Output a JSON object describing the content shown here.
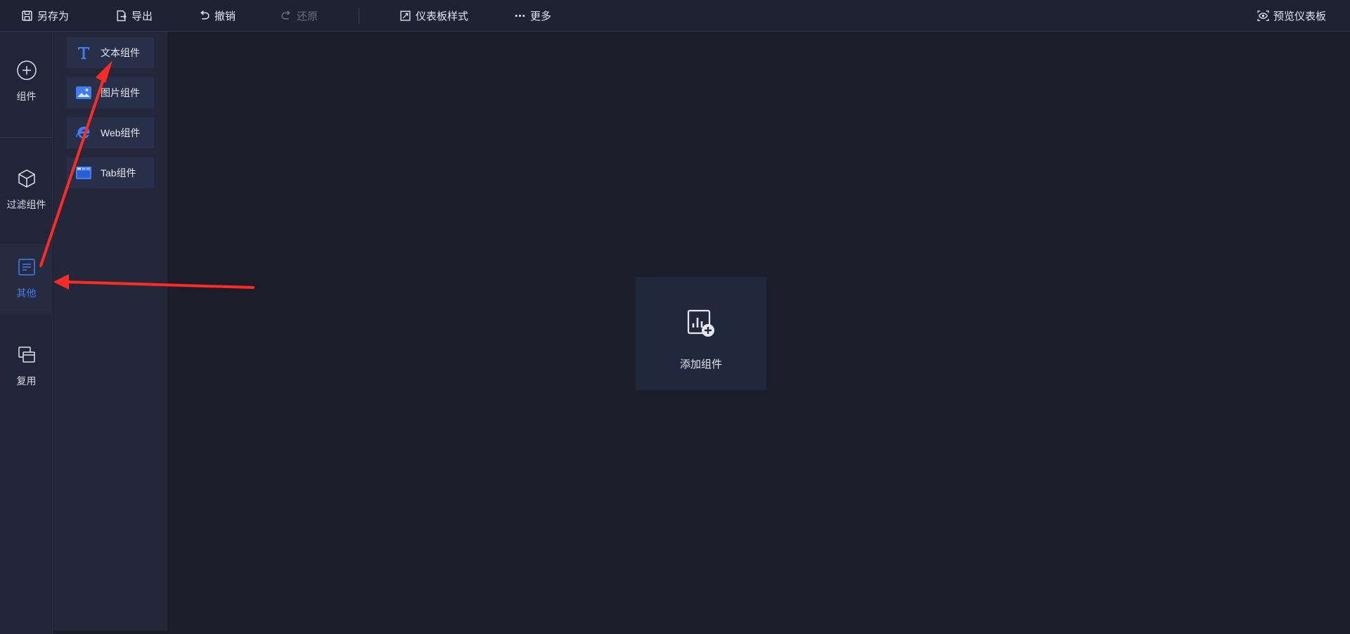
{
  "toolbar": {
    "save_as": "另存为",
    "export": "导出",
    "undo": "撤销",
    "redo": "还原",
    "dashboard_style": "仪表板样式",
    "more": "更多",
    "preview": "预览仪表板"
  },
  "rail": {
    "items": [
      {
        "label": "组件",
        "icon": "plus-circle-icon"
      },
      {
        "label": "过滤组件",
        "icon": "cube-icon"
      },
      {
        "label": "其他",
        "icon": "document-icon",
        "active": true
      },
      {
        "label": "复用",
        "icon": "stack-icon"
      }
    ]
  },
  "panel": {
    "components": [
      {
        "label": "文本组件",
        "icon": "text-t-icon"
      },
      {
        "label": "图片组件",
        "icon": "image-icon"
      },
      {
        "label": "Web组件",
        "icon": "web-e-icon"
      },
      {
        "label": "Tab组件",
        "icon": "tab-icon"
      }
    ]
  },
  "canvas": {
    "add_label": "添加组件"
  },
  "colors": {
    "accent": "#3f7cf5",
    "background": "#1b1d2b",
    "annotation_arrow": "#ff2a24"
  }
}
